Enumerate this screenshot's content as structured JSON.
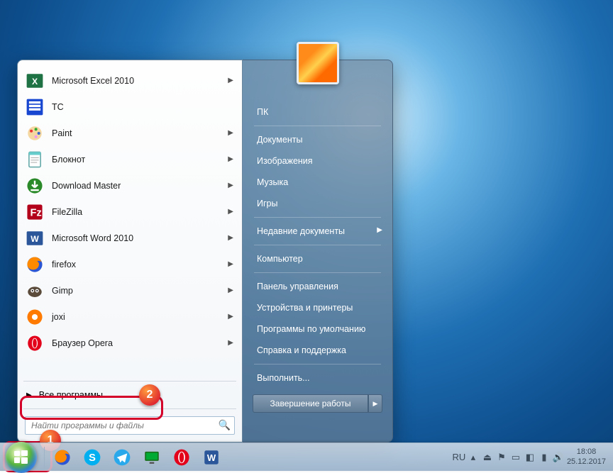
{
  "programs": [
    {
      "label": "Microsoft Excel 2010",
      "icon": "excel",
      "arrow": true
    },
    {
      "label": "TC",
      "icon": "tc",
      "arrow": false
    },
    {
      "label": "Paint",
      "icon": "paint",
      "arrow": true
    },
    {
      "label": "Блокнот",
      "icon": "notepad",
      "arrow": true
    },
    {
      "label": "Download Master",
      "icon": "dmaster",
      "arrow": true
    },
    {
      "label": "FileZilla",
      "icon": "filezilla",
      "arrow": true
    },
    {
      "label": "Microsoft Word 2010",
      "icon": "word",
      "arrow": true
    },
    {
      "label": "firefox",
      "icon": "firefox",
      "arrow": true
    },
    {
      "label": "Gimp",
      "icon": "gimp",
      "arrow": true
    },
    {
      "label": "joxi",
      "icon": "joxi",
      "arrow": true
    },
    {
      "label": "Браузер Opera",
      "icon": "opera",
      "arrow": true
    }
  ],
  "all_programs": "Все программы",
  "search_placeholder": "Найти программы и файлы",
  "right_panel": {
    "user": "ПК",
    "items": [
      "Документы",
      "Изображения",
      "Музыка",
      "Игры",
      "Недавние документы",
      "Компьютер",
      "Панель управления",
      "Устройства и принтеры",
      "Программы по умолчанию",
      "Справка и поддержка",
      "Выполнить..."
    ],
    "recent_has_arrow_index": 4,
    "separators_after": [
      3,
      4,
      5,
      9
    ]
  },
  "shutdown": "Завершение работы",
  "tray": {
    "lang": "RU",
    "time": "18:08",
    "date": "25.12.2017"
  },
  "annotations": {
    "1": "1",
    "2": "2"
  }
}
